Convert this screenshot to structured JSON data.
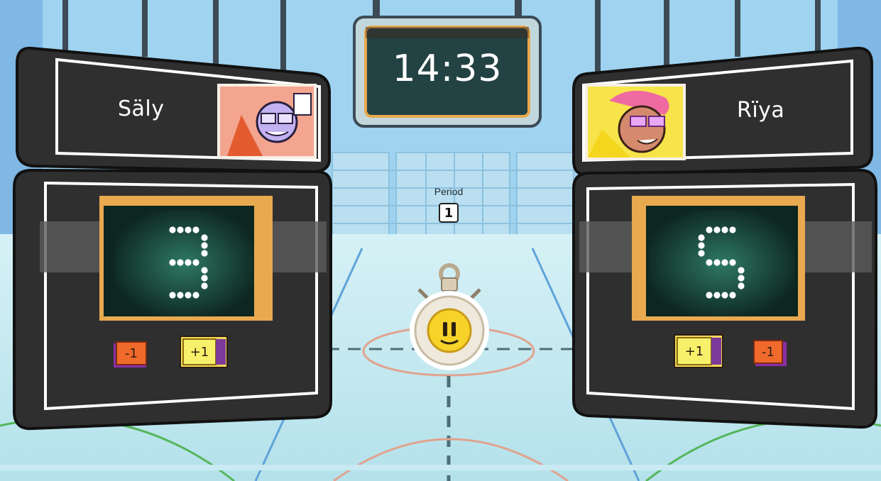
{
  "colors": {
    "sky": "#a9dcf5",
    "court": "#c6e9f2",
    "board": "#3a3a3a",
    "screen": "#0e2721",
    "plus_button": "#f7f06a",
    "minus_button": "#f06a2c",
    "clock_screen": "#234243",
    "accent_gold": "#e8a94f"
  },
  "clock": {
    "time": "14:33"
  },
  "period": {
    "label": "Period",
    "value": "1"
  },
  "stopwatch": {
    "icon": "pause-icon"
  },
  "players": [
    {
      "name": "Säly",
      "score": 3,
      "avatar": "cartoon-character-purple-glasses",
      "minus_label": "-1",
      "plus_label": "+1"
    },
    {
      "name": "Rïya",
      "score": 5,
      "avatar": "cartoon-character-pink-hair",
      "minus_label": "-1",
      "plus_label": "+1"
    }
  ]
}
